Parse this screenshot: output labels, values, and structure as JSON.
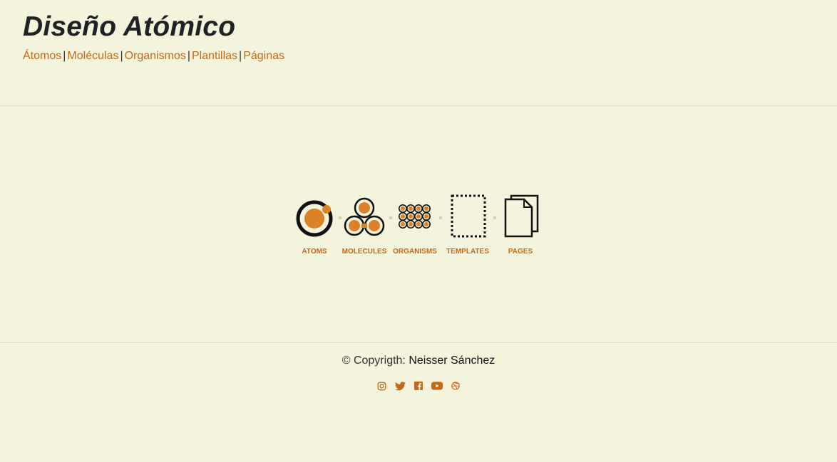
{
  "header": {
    "title": "Diseño Atómico",
    "nav": [
      {
        "label": "Átomos"
      },
      {
        "label": "Moléculas"
      },
      {
        "label": "Organismos"
      },
      {
        "label": "Plantillas"
      },
      {
        "label": "Páginas"
      }
    ],
    "separator": "|"
  },
  "hero": {
    "stages": [
      "ATOMS",
      "MOLECULES",
      "ORGANISMS",
      "TEMPLATES",
      "PAGES"
    ]
  },
  "footer": {
    "copyright_prefix": "© Copyrigth:",
    "author": "Neisser Sánchez",
    "socials": [
      {
        "icon": "instagram-icon"
      },
      {
        "icon": "twitter-icon"
      },
      {
        "icon": "facebook-icon"
      },
      {
        "icon": "youtube-icon"
      },
      {
        "icon": "dribbble-icon"
      }
    ]
  },
  "colors": {
    "background": "#f4f3dc",
    "accent": "#c26a1b",
    "hero_orange": "#dc8126",
    "title": "#1f2225"
  }
}
